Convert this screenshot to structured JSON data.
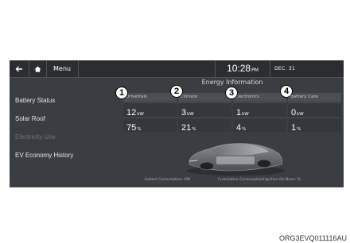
{
  "topbar": {
    "menu_label": "Menu",
    "time": "10:28",
    "ampm": "PM",
    "date": "DEC. 31"
  },
  "sidebar": {
    "items": [
      {
        "label": "Battery Status",
        "dimmed": false
      },
      {
        "label": "Solar Roof",
        "dimmed": false
      },
      {
        "label": "Electricity Use",
        "dimmed": true
      },
      {
        "label": "EV Economy History",
        "dimmed": false
      }
    ]
  },
  "main": {
    "title": "Energy Information",
    "columns": [
      {
        "marker": "1",
        "header": "Drivetrain",
        "power": "12",
        "power_unit": "kW",
        "percent": "75",
        "percent_unit": "%"
      },
      {
        "marker": "2",
        "header": "Climate",
        "power": "3",
        "power_unit": "kW",
        "percent": "21",
        "percent_unit": "%"
      },
      {
        "marker": "3",
        "header": "Electronics",
        "power": "1",
        "power_unit": "kW",
        "percent": "4",
        "percent_unit": "%"
      },
      {
        "marker": "4",
        "header": "Battery Care",
        "power": "0",
        "power_unit": "kW",
        "percent": "1",
        "percent_unit": "%"
      }
    ],
    "instant_consumption": "Instant Consumption: KW",
    "cumulative_consumption": "Cumulative Consumption(Ignition On-Now): %"
  },
  "icons": {
    "back": "back-arrow-icon",
    "home": "home-icon",
    "car": "car-illustration"
  },
  "watermark": "ORG3EVQ011116AU",
  "colors": {
    "screen_bg": "#3a3d41",
    "topbar_bg": "#2b2d30",
    "cell_bg": "#34373b",
    "header_bg": "#4b4f54",
    "text": "#ffffff",
    "dim_text": "#6f7379"
  }
}
